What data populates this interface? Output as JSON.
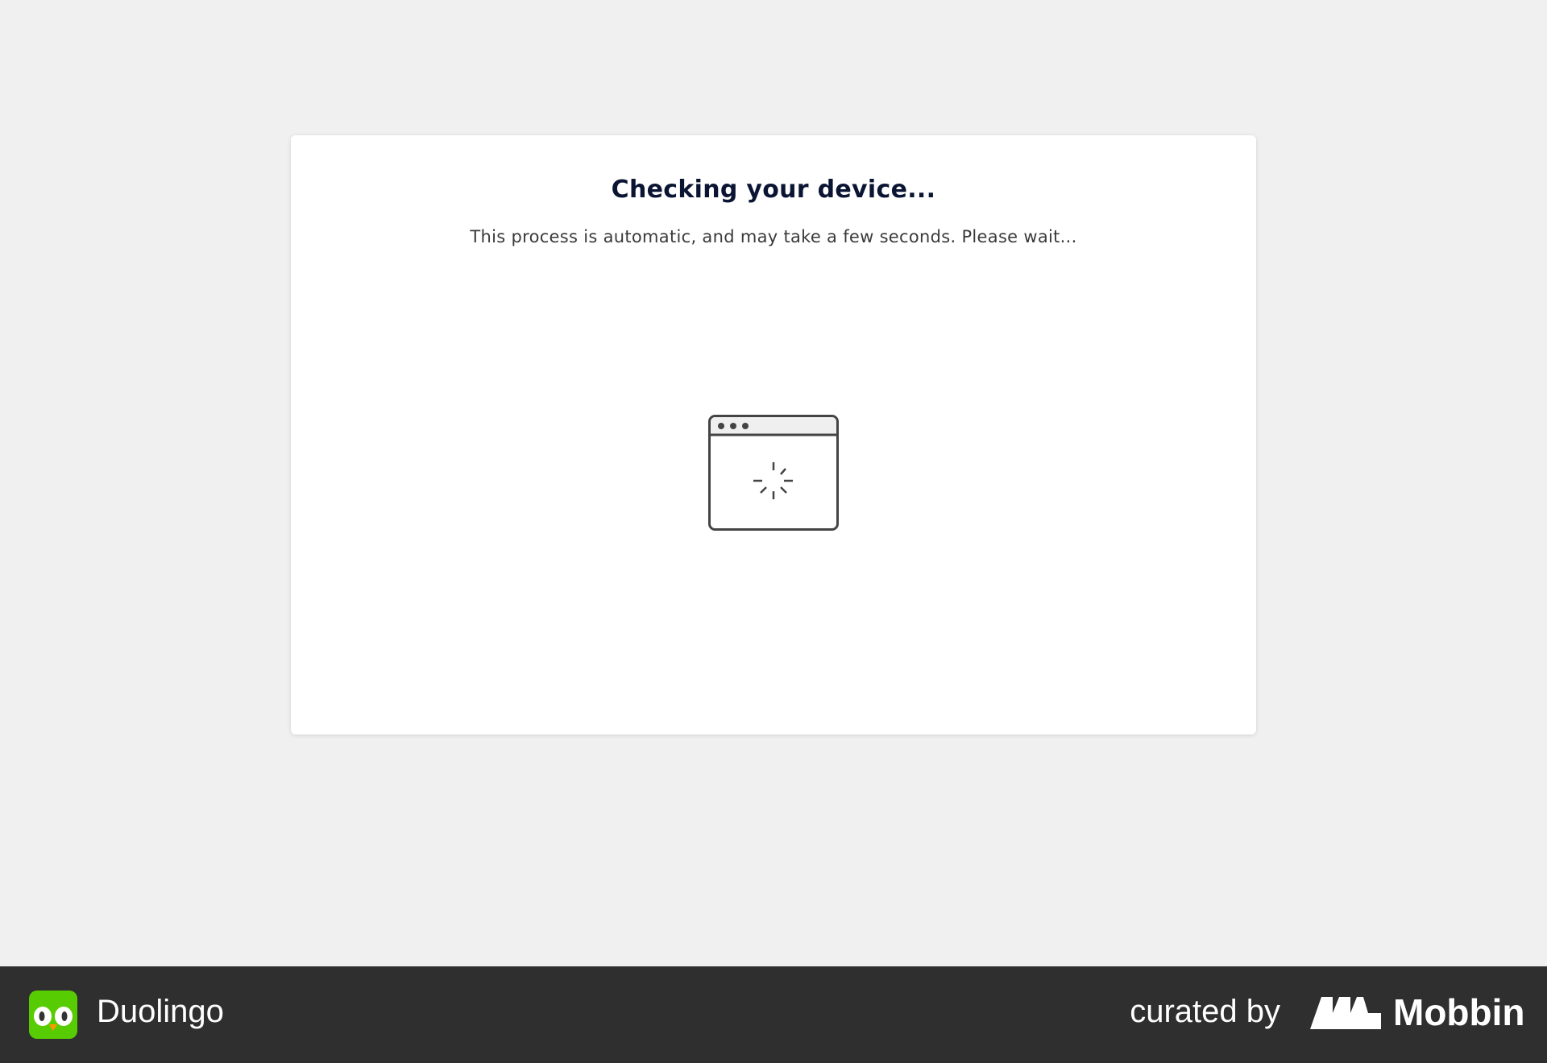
{
  "main": {
    "title": "Checking your device...",
    "subtitle": "This process is automatic, and may take a few seconds. Please wait...",
    "icon": "browser-loading-icon"
  },
  "footer": {
    "app_name": "Duolingo",
    "app_icon": "duolingo-owl-icon",
    "curated_by": "curated by",
    "brand": "Mobbin",
    "brand_icon": "mobbin-logo-icon",
    "background": "#2f2f2f",
    "app_color": "#58cc02"
  }
}
